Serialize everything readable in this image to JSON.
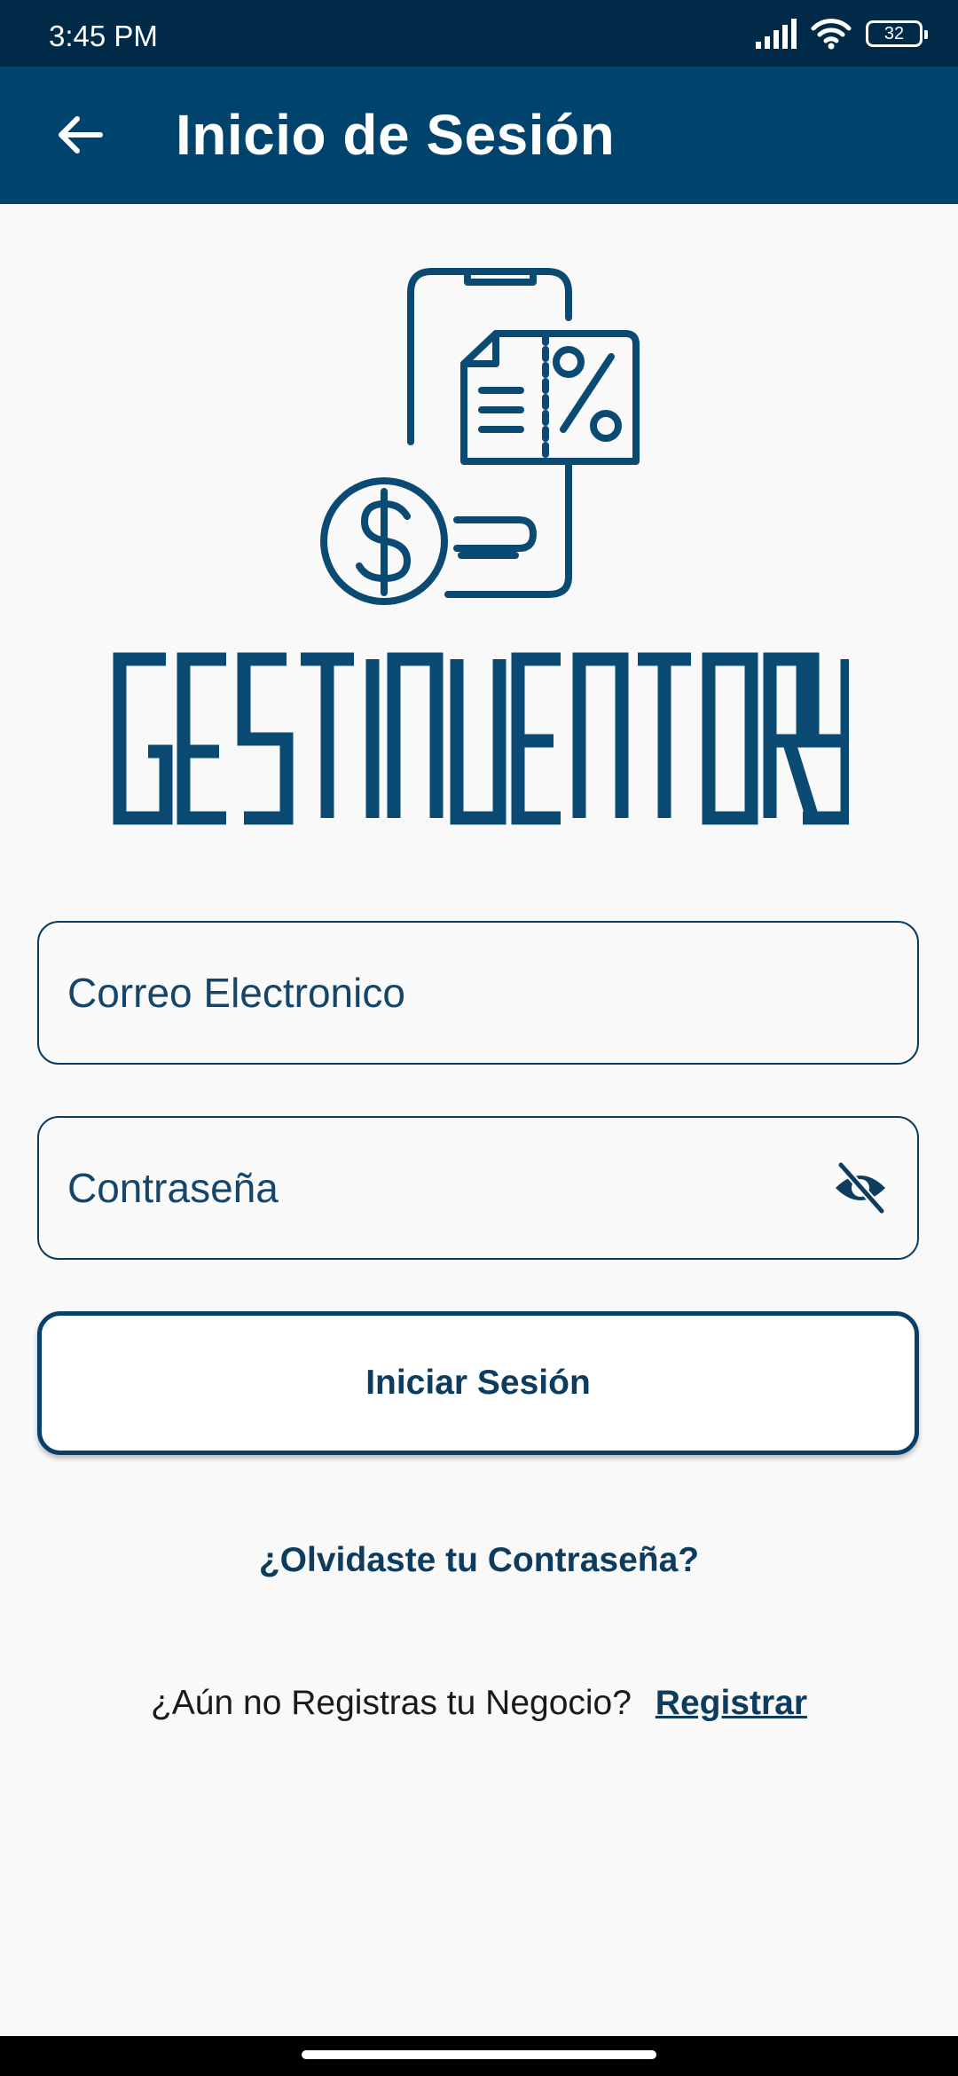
{
  "status_bar": {
    "time": "3:45 PM",
    "battery_level": "32",
    "icons": [
      "signal-icon",
      "wifi-icon",
      "battery-icon"
    ]
  },
  "app_bar": {
    "title": "Inicio de Sesión",
    "back_icon": "arrow-left-icon"
  },
  "logo": {
    "brand_name": "GESTINVENTORY",
    "icon": "phone-invoice-discount-dollar-icon",
    "color": "#0b4a72"
  },
  "form": {
    "email": {
      "placeholder": "Correo Electronico",
      "value": ""
    },
    "password": {
      "placeholder": "Contraseña",
      "value": "",
      "toggle_icon": "eye-off-icon"
    },
    "submit_label": "Iniciar Sesión"
  },
  "forgot_password": "¿Olvidaste tu Contraseña?",
  "register": {
    "prompt": "¿Aún no Registras tu Negocio?",
    "link": "Registrar"
  },
  "colors": {
    "status_bar": "#002a48",
    "app_bar": "#00436c",
    "accent": "#0d3c5e",
    "background": "#f9f9f9"
  }
}
